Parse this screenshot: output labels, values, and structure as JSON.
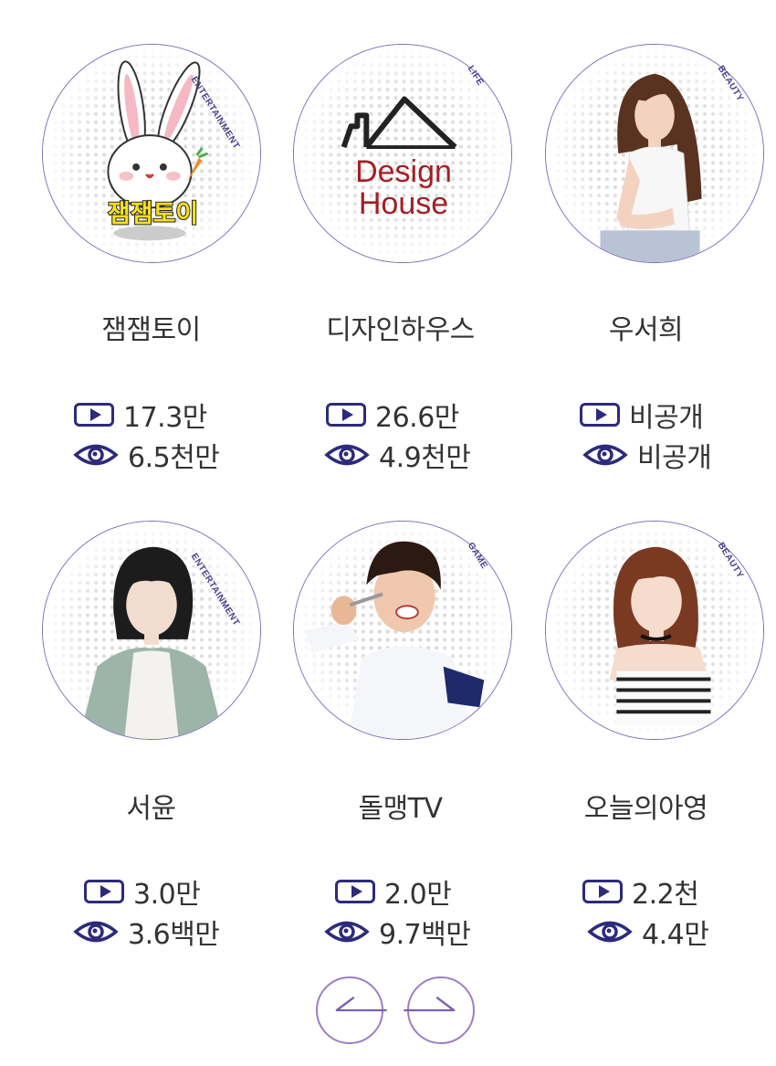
{
  "creators": [
    {
      "name": "잼잼토이",
      "category": "ENTERTAINMENT",
      "videos": "17.3만",
      "views": "6.5천만",
      "logo_text": "잼잼토이"
    },
    {
      "name": "디자인하우스",
      "category": "LIFE",
      "videos": "26.6만",
      "views": "4.9천만",
      "logo_text_1": "Design",
      "logo_text_2": "House"
    },
    {
      "name": "우서희",
      "category": "BEAUTY",
      "videos": "비공개",
      "views": "비공개"
    },
    {
      "name": "서윤",
      "category": "ENTERTAINMENT",
      "videos": "3.0만",
      "views": "3.6백만"
    },
    {
      "name": "돌맹TV",
      "category": "GAME",
      "videos": "2.0만",
      "views": "9.7백만"
    },
    {
      "name": "오늘의아영",
      "category": "BEAUTY",
      "videos": "2.2천",
      "views": "4.4만"
    }
  ],
  "colors": {
    "accent": "#2e2a7a",
    "border": "#7a6fb8",
    "nav_gradient": "#9b7fc4"
  },
  "icons": {
    "videos": "play-icon",
    "views": "eye-icon",
    "prev": "arrow-left-icon",
    "next": "arrow-right-icon"
  }
}
